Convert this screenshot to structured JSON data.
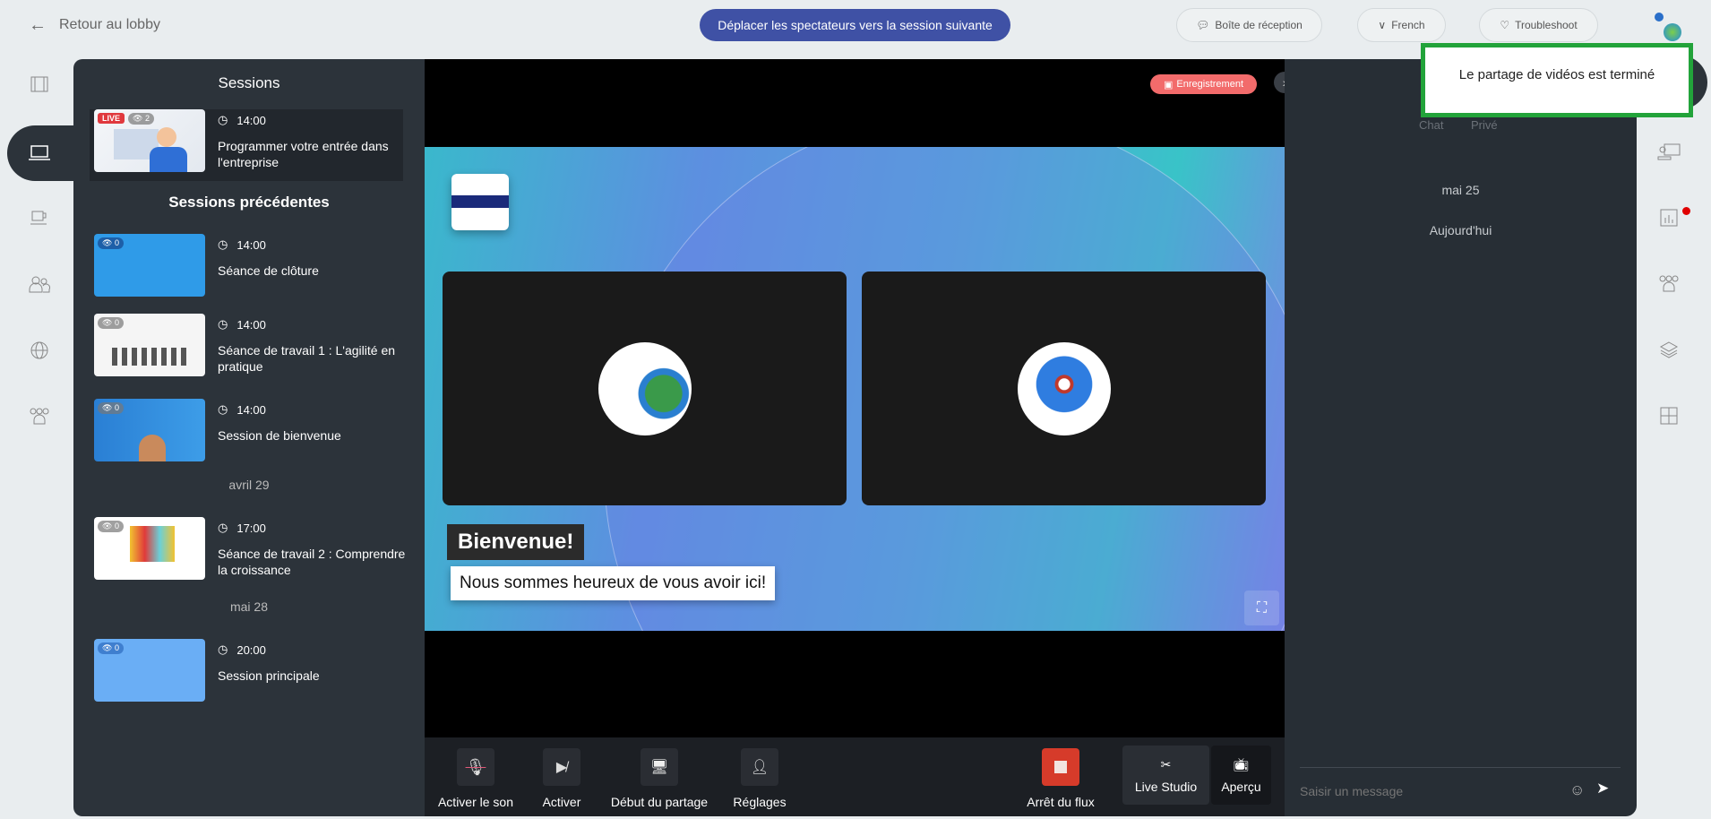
{
  "header": {
    "back_label": "Retour au lobby",
    "move_viewers_label": "Déplacer les spectateurs vers la session suivante",
    "inbox_label": "Boîte de réception",
    "language_label": "French",
    "troubleshoot_label": "Troubleshoot"
  },
  "toast": {
    "message": "Le partage de vidéos est terminé"
  },
  "left_rail": {
    "icons": [
      "film-icon",
      "laptop-icon",
      "coffee-cup-icon",
      "people-icon",
      "globe-icon",
      "group-icon"
    ],
    "active": "laptop-icon"
  },
  "sessions": {
    "title": "Sessions",
    "live": {
      "badge": "LIVE",
      "viewers": "2",
      "time": "14:00",
      "title": "Programmer votre entrée dans l'entreprise"
    },
    "previous_title": "Sessions précédentes",
    "previous": [
      {
        "viewers": "0",
        "time": "14:00",
        "title": "Séance de clôture"
      },
      {
        "viewers": "0",
        "time": "14:00",
        "title": "Séance de travail 1 : L'agilité en pratique"
      },
      {
        "viewers": "0",
        "time": "14:00",
        "title": "Session de bienvenue"
      },
      {
        "date": "avril 29",
        "viewers": "0",
        "time": "17:00",
        "title": "Séance de travail 2 : Comprendre la croissance"
      },
      {
        "date": "mai 28",
        "viewers": "0",
        "time": "20:00",
        "title": "Session principale"
      }
    ]
  },
  "stage": {
    "recording_label": "Enregistrement",
    "banner_title": "Bienvenue!",
    "banner_subtitle": "Nous sommes heureux de vous avoir ici!"
  },
  "toolbar": {
    "unmute": "Activer le son",
    "camera": "Activer",
    "share": "Début du partage",
    "settings": "Réglages",
    "stop_stream": "Arrêt du flux",
    "live_studio": "Live Studio",
    "preview": "Aperçu"
  },
  "chat": {
    "tabs": [
      "Chat",
      "Privé"
    ],
    "dates": [
      "mai 25",
      "Aujourd'hui"
    ],
    "placeholder": "Saisir un message"
  },
  "colors": {
    "accent": "#3f51a5",
    "recording": "#f26b6b",
    "stop": "#d63b2a",
    "toast_border": "#22a33a",
    "notification": "#e00000"
  }
}
